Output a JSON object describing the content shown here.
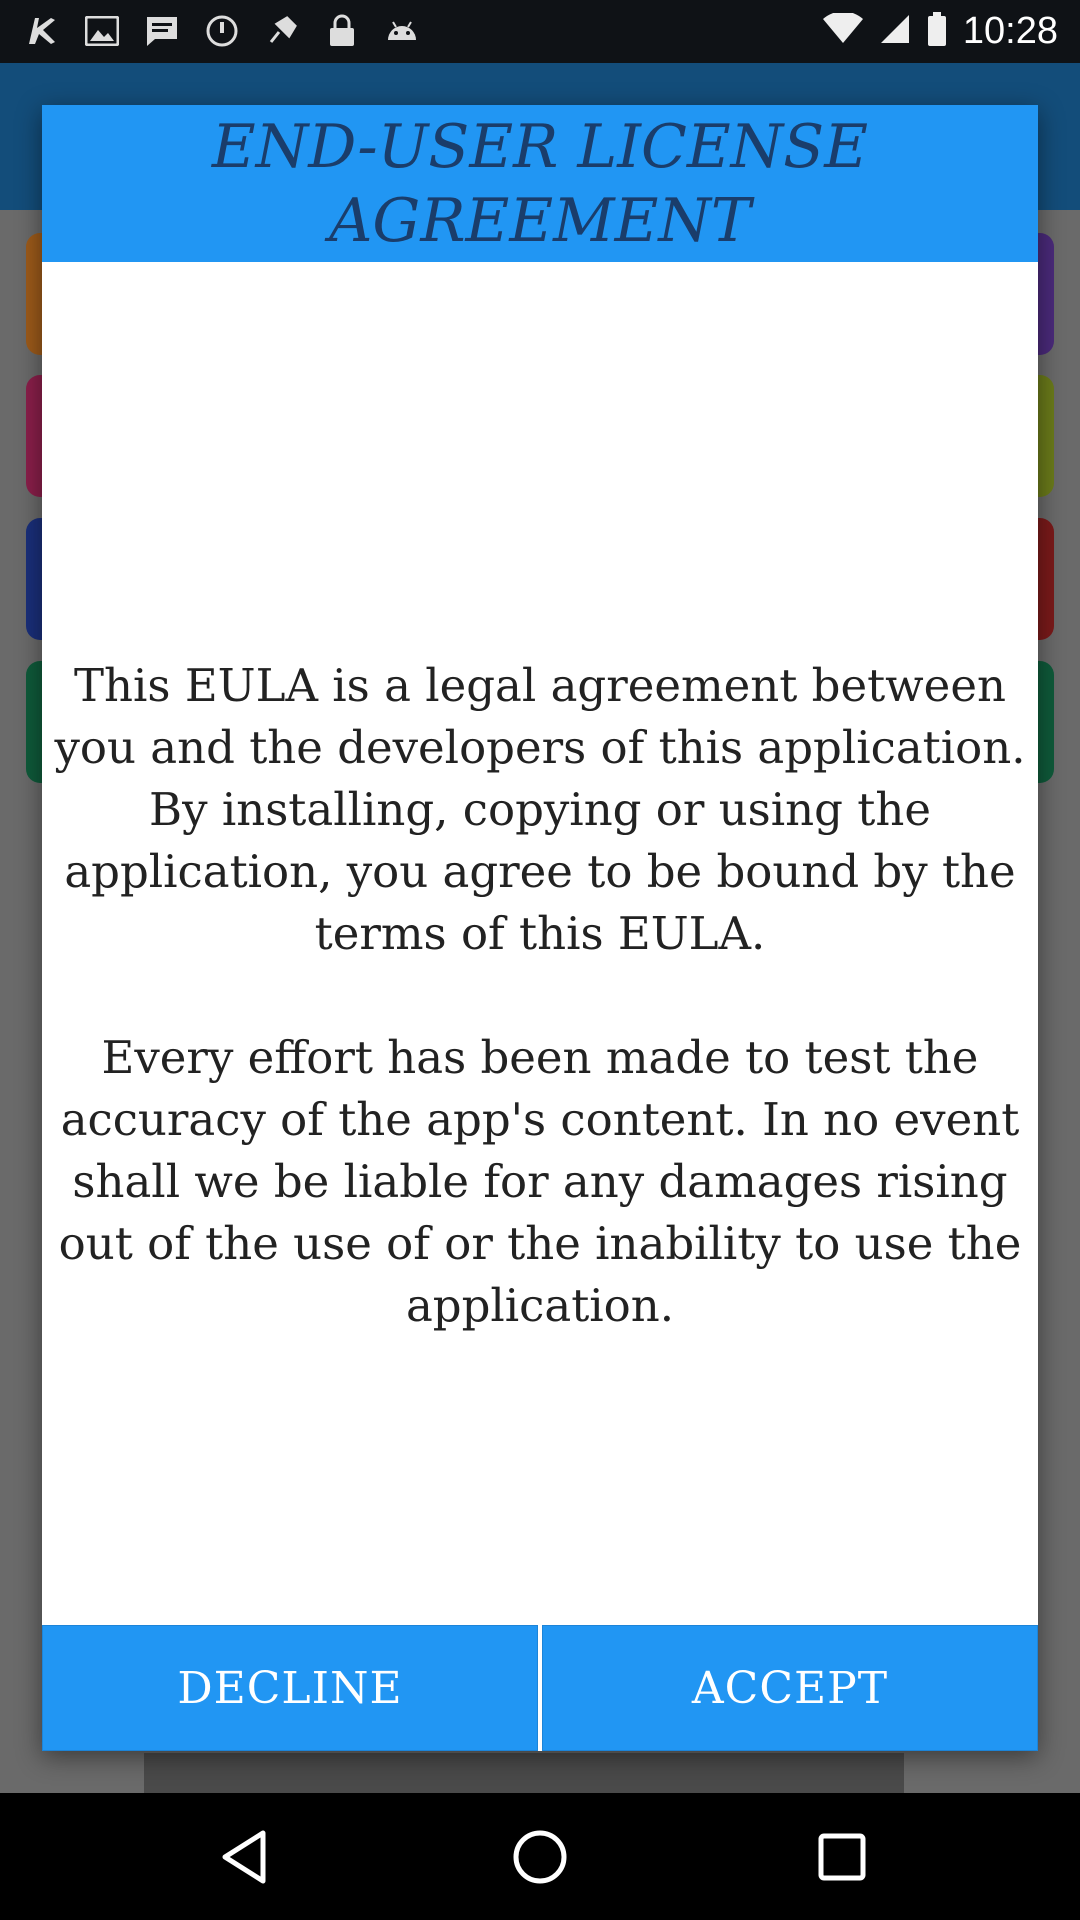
{
  "status_bar": {
    "time": "10:28",
    "icons": [
      "app-icon",
      "image-icon",
      "message-icon",
      "do-not-disturb-icon",
      "location-icon",
      "lock-icon",
      "android-icon"
    ]
  },
  "dialog": {
    "title": "END-USER LICENSE AGREEMENT",
    "paragraphs": [
      "This EULA is a legal agreement between you and the developers of this application. By installing, copying or using the application, you agree to be bound by the terms of this EULA.",
      "Every effort has been made to test the accuracy of the app's content. In no event shall we be liable for any damages rising out of the use of or the inability to use the application."
    ],
    "decline_label": "DECLINE",
    "accept_label": "ACCEPT"
  },
  "colors": {
    "accent": "#2196f3",
    "title_text": "#1a3d6b"
  },
  "nav_bar": {
    "buttons": [
      "back-icon",
      "home-icon",
      "recents-icon"
    ]
  }
}
